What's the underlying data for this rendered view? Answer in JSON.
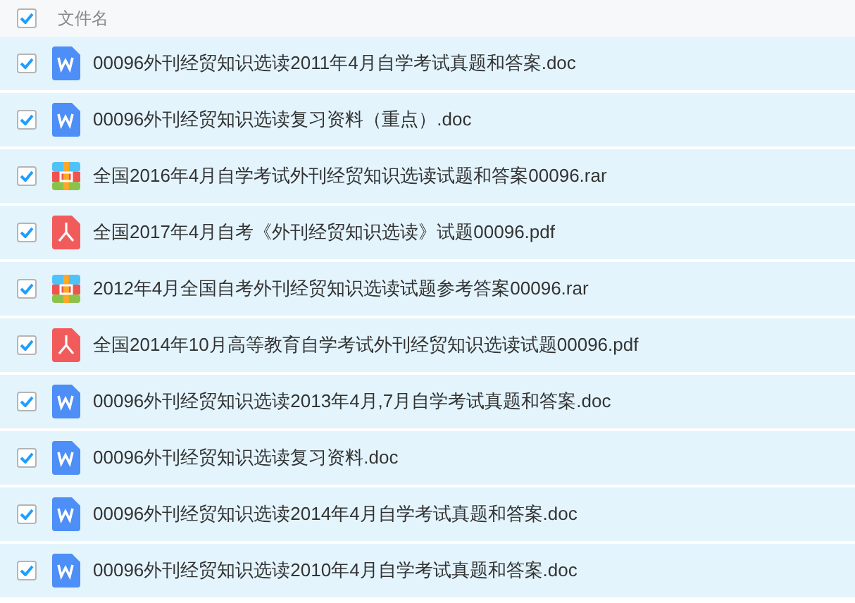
{
  "header": {
    "checked": true,
    "column_label": "文件名"
  },
  "files": [
    {
      "name": "00096外刊经贸知识选读2011年4月自学考试真题和答案.doc",
      "kind": "doc",
      "checked": true
    },
    {
      "name": "00096外刊经贸知识选读复习资料（重点）.doc",
      "kind": "doc",
      "checked": true
    },
    {
      "name": "全国2016年4月自学考试外刊经贸知识选读试题和答案00096.rar",
      "kind": "rar",
      "checked": true
    },
    {
      "name": "全国2017年4月自考《外刊经贸知识选读》试题00096.pdf",
      "kind": "pdf",
      "checked": true
    },
    {
      "name": "2012年4月全国自考外刊经贸知识选读试题参考答案00096.rar",
      "kind": "rar",
      "checked": true
    },
    {
      "name": "全国2014年10月高等教育自学考试外刊经贸知识选读试题00096.pdf",
      "kind": "pdf",
      "checked": true
    },
    {
      "name": "00096外刊经贸知识选读2013年4月,7月自学考试真题和答案.doc",
      "kind": "doc",
      "checked": true
    },
    {
      "name": "00096外刊经贸知识选读复习资料.doc",
      "kind": "doc",
      "checked": true
    },
    {
      "name": "00096外刊经贸知识选读2014年4月自学考试真题和答案.doc",
      "kind": "doc",
      "checked": true
    },
    {
      "name": "00096外刊经贸知识选读2010年4月自学考试真题和答案.doc",
      "kind": "doc",
      "checked": true
    }
  ]
}
